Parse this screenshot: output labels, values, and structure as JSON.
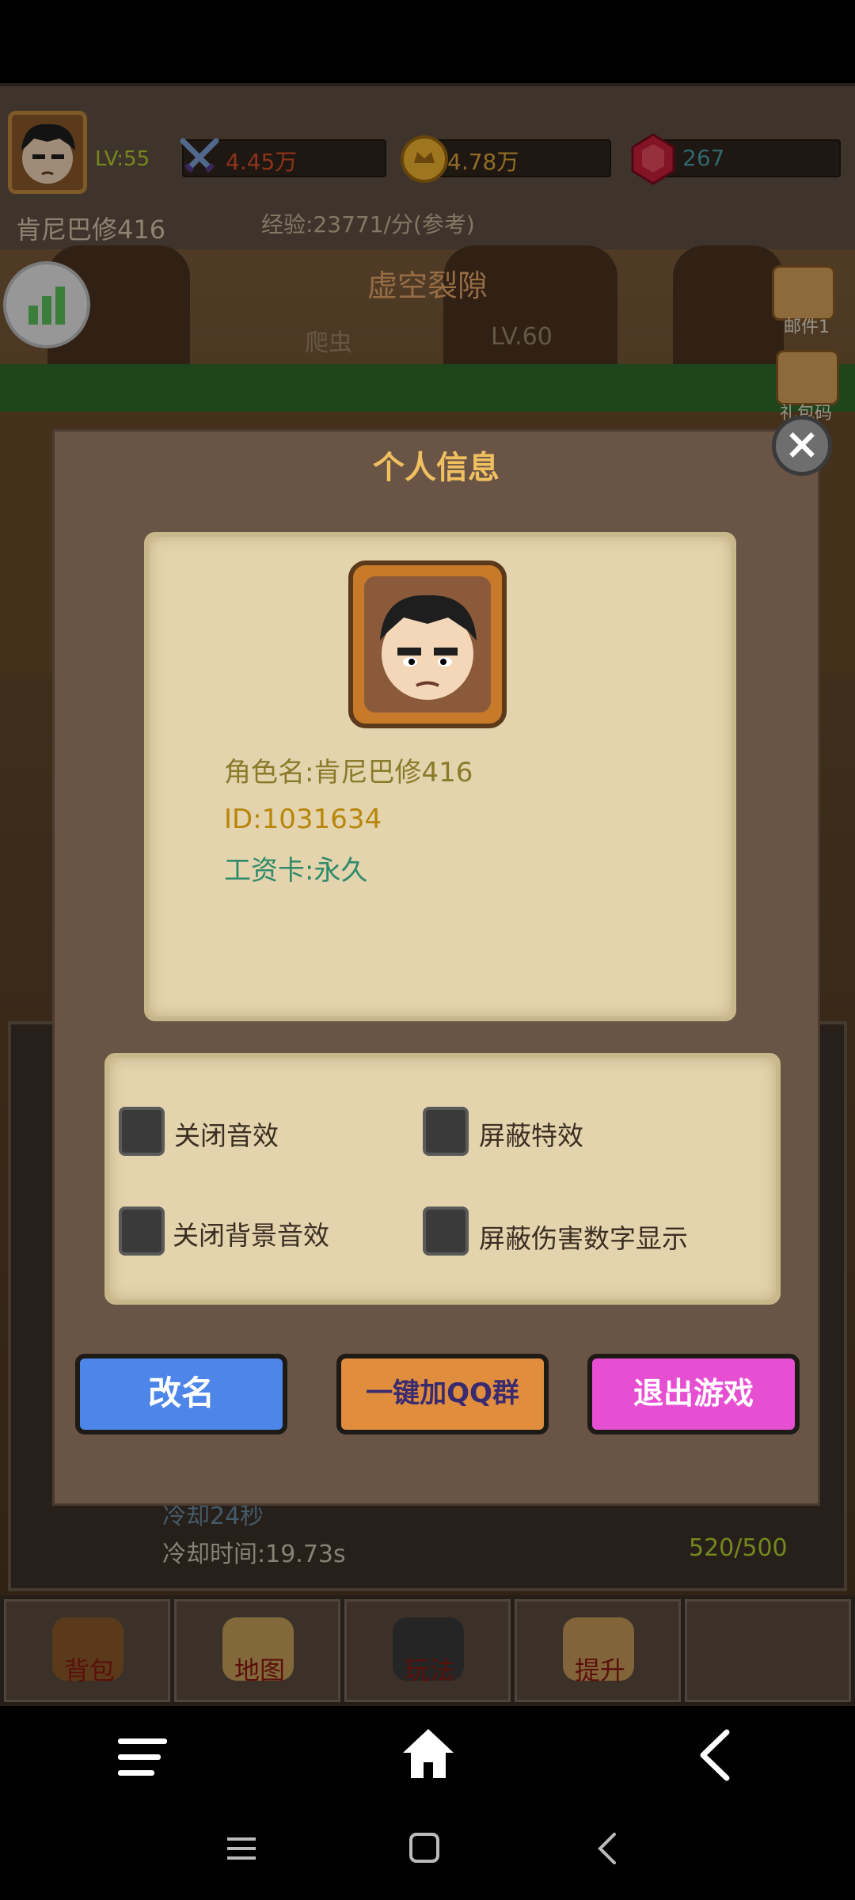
{
  "hud": {
    "level": "LV:55",
    "power": "4.45万",
    "gold": "4.78万",
    "gems": "267",
    "player_name": "肯尼巴修416",
    "exp_rate": "经验:23771/分(参考)"
  },
  "scene": {
    "zone_title": "虚空裂隙",
    "monster": "爬虫",
    "monster_level": "LV.60",
    "mail_label": "邮件",
    "mail_count": "1",
    "gift_label": "礼包码",
    "cooldown": "冷却时间:19.73s",
    "cooldown_partial": "冷却24秒",
    "capacity": "520/500"
  },
  "game_nav": {
    "items": [
      {
        "label": "背包",
        "icon": "bag-icon"
      },
      {
        "label": "地图",
        "icon": "map-icon"
      },
      {
        "label": "玩法",
        "icon": "gamepad-icon"
      },
      {
        "label": "提升",
        "icon": "fist-icon"
      }
    ]
  },
  "dialog": {
    "title": "个人信息",
    "role_name": "角色名:肯尼巴修416",
    "id": "ID:1031634",
    "salary_card": "工资卡:永久",
    "options": [
      {
        "label": "关闭音效",
        "checked": false
      },
      {
        "label": "屏蔽特效",
        "checked": false
      },
      {
        "label": "关闭背景音效",
        "checked": false
      },
      {
        "label": "屏蔽伤害数字显示",
        "checked": false
      }
    ],
    "rename_button": "改名",
    "join_qq_button": "一键加QQ群",
    "exit_button": "退出游戏"
  },
  "colors": {
    "role_name": "#8a7a2a",
    "id": "#b8860b",
    "salary_card": "#2f8a6a"
  }
}
